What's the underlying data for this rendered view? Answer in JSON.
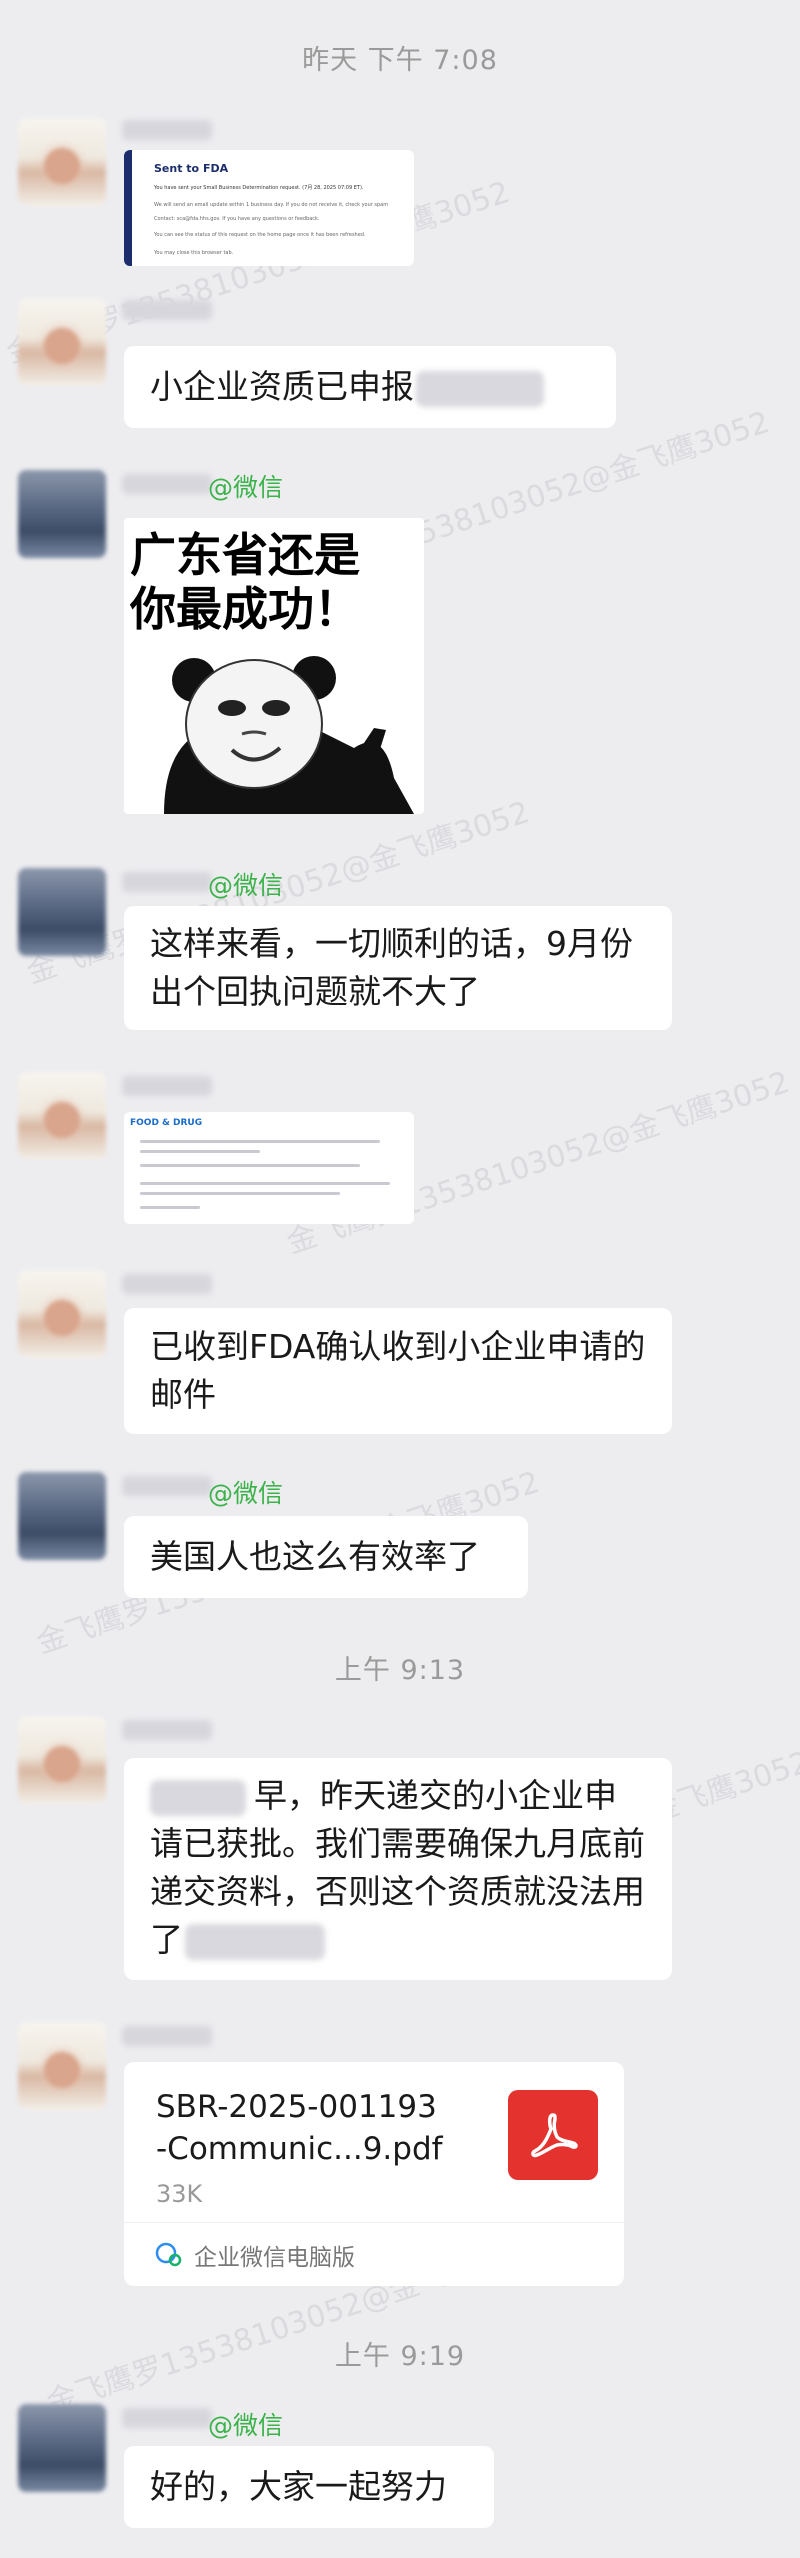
{
  "timestamps": {
    "t1": "昨天 下午 7:08",
    "t2": "上午 9:13",
    "t3": "上午 9:19"
  },
  "mention": "@微信",
  "fda_card": {
    "title": "Sent to FDA",
    "line1": "You have sent your Small Business Determination request. (7月 28, 2025 07:09 ET).",
    "line2": "We will send an email update within 1 business day. If you do not receive it, check your spam",
    "line3": "Contact: sca@fda.hhs.gov. If you have any questions or feedback.",
    "line4": "You can see the status of this request on the home page once it has been refreshed.",
    "line5": "You may close this browser tab."
  },
  "messages": {
    "m1": "小企业资质已申报",
    "meme_line1": "广东省还是",
    "meme_line2": "你最成功！",
    "m2": "这样来看，一切顺利的话，9月份出个回执问题就不大了",
    "email_header": "FOOD & DRUG",
    "m3": "已收到FDA确认收到小企业申请的邮件",
    "m4": "美国人也这么有效率了",
    "m5_after": "早，昨天递交的小企业申请已获批。我们需要确保九月底前递交资料，否则这个资质就没法用了",
    "m6": "好的，大家一起努力"
  },
  "file": {
    "name_line1": "SBR-2025-001193",
    "name_line2": "-Communic...9.pdf",
    "size": "33K",
    "source": "企业微信电脑版"
  },
  "watermark_text": "金飞鹰罗13538103052@金飞鹰3052",
  "colors": {
    "background": "#ededf0",
    "bubble": "#ffffff",
    "mention": "#3bb34a",
    "pdf": "#e4332f"
  }
}
